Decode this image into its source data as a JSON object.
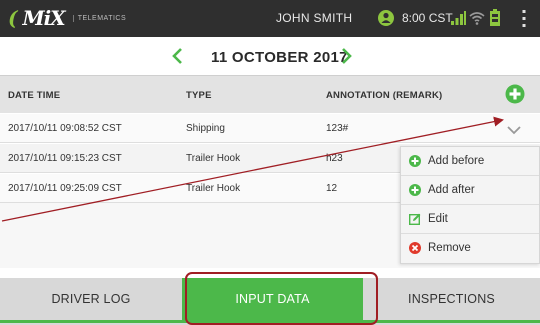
{
  "header": {
    "brand": "MiX",
    "brand_sub": "TELEMATICS",
    "user": "JOHN SMITH",
    "time": "8:00 CST",
    "icons": [
      "driver-status-icon",
      "signal-icon",
      "wifi-icon",
      "battery-icon",
      "overflow-menu-icon"
    ]
  },
  "datebar": {
    "date": "11 OCTOBER 2017",
    "prev_icon": "chevron-left-icon",
    "next_icon": "chevron-right-icon"
  },
  "table": {
    "columns": [
      "DATE TIME",
      "TYPE",
      "ANNOTATION (REMARK)"
    ],
    "rows": [
      {
        "datetime": "2017/10/11 09:08:52 CST",
        "type": "Shipping",
        "remark": "123#"
      },
      {
        "datetime": "2017/10/11 09:15:23 CST",
        "type": "Trailer Hook",
        "remark": "h23"
      },
      {
        "datetime": "2017/10/11 09:25:09 CST",
        "type": "Trailer Hook",
        "remark": "12"
      }
    ]
  },
  "menu": {
    "items": [
      {
        "label": "Add before",
        "icon": "plus-circle-icon",
        "color": "#4cb84a"
      },
      {
        "label": "Add after",
        "icon": "plus-circle-icon",
        "color": "#4cb84a"
      },
      {
        "label": "Edit",
        "icon": "edit-icon",
        "color": "#4cb84a"
      },
      {
        "label": "Remove",
        "icon": "remove-circle-icon",
        "color": "#e0392b"
      }
    ]
  },
  "tabs": [
    {
      "label": "DRIVER LOG",
      "active": false
    },
    {
      "label": "INPUT DATA",
      "active": true
    },
    {
      "label": "INSPECTIONS",
      "active": false
    }
  ],
  "colors": {
    "accent": "#4cb84a",
    "topbar": "#2f2f2f",
    "annotation": "#a01e24"
  }
}
